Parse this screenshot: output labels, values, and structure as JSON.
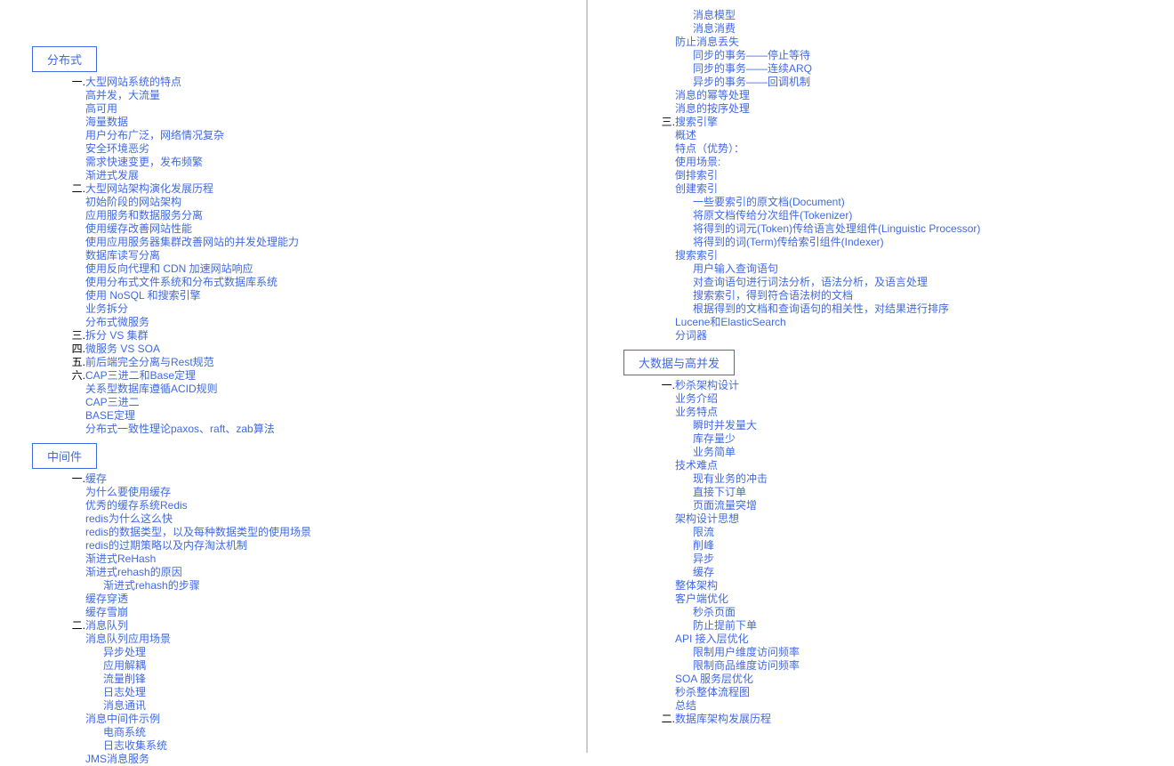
{
  "left": {
    "section1": {
      "title": "分布式",
      "items": [
        {
          "num": "一.",
          "text": "大型网站系统的特点",
          "indent": 0
        },
        {
          "text": "高并发，大流量",
          "indent": 1
        },
        {
          "text": "高可用",
          "indent": 1
        },
        {
          "text": "海量数据",
          "indent": 1
        },
        {
          "text": "用户分布广泛，网络情况复杂",
          "indent": 1
        },
        {
          "text": "安全环境恶劣",
          "indent": 1
        },
        {
          "text": "需求快速变更，发布频繁",
          "indent": 1
        },
        {
          "text": "渐进式发展",
          "indent": 1
        },
        {
          "num": "二.",
          "text": "大型网站架构演化发展历程",
          "indent": 0
        },
        {
          "text": "初始阶段的网站架构",
          "indent": 1
        },
        {
          "text": "应用服务和数据服务分离",
          "indent": 1
        },
        {
          "text": "使用缓存改善网站性能",
          "indent": 1
        },
        {
          "text": "使用应用服务器集群改善网站的并发处理能力",
          "indent": 1
        },
        {
          "text": "数据库读写分离",
          "indent": 1
        },
        {
          "text": "使用反向代理和 CDN 加速网站响应",
          "indent": 1
        },
        {
          "text": "使用分布式文件系统和分布式数据库系统",
          "indent": 1
        },
        {
          "text": "使用 NoSQL 和搜索引擎",
          "indent": 1
        },
        {
          "text": "业务拆分",
          "indent": 1
        },
        {
          "text": "分布式微服务",
          "indent": 1
        },
        {
          "num": "三.",
          "text": "拆分 VS 集群",
          "indent": 0
        },
        {
          "num": "四.",
          "text": "微服务 VS SOA",
          "indent": 0
        },
        {
          "num": "五.",
          "text": "前后端完全分离与Rest规范",
          "indent": 0
        },
        {
          "num": "六.",
          "text": "CAP三进二和Base定理",
          "indent": 0
        },
        {
          "text": "关系型数据库遵循ACID规则",
          "indent": 1
        },
        {
          "text": "CAP三进二",
          "indent": 1
        },
        {
          "text": "BASE定理",
          "indent": 1
        },
        {
          "text": "分布式一致性理论paxos、raft、zab算法",
          "indent": 1
        }
      ]
    },
    "section2": {
      "title": "中间件",
      "items": [
        {
          "num": "一.",
          "text": "缓存",
          "indent": 0
        },
        {
          "text": "为什么要使用缓存",
          "indent": 1
        },
        {
          "text": "优秀的缓存系统Redis",
          "indent": 1
        },
        {
          "text": "redis为什么这么快",
          "indent": 1
        },
        {
          "text": "redis的数据类型，以及每种数据类型的使用场景",
          "indent": 1
        },
        {
          "text": "redis的过期策略以及内存淘汰机制",
          "indent": 1
        },
        {
          "text": "渐进式ReHash",
          "indent": 1
        },
        {
          "text": "渐进式rehash的原因",
          "indent": 1
        },
        {
          "text": "渐进式rehash的步骤",
          "indent": 2
        },
        {
          "text": "缓存穿透",
          "indent": 1
        },
        {
          "text": "缓存雪崩",
          "indent": 1
        },
        {
          "num": "二.",
          "text": "消息队列",
          "indent": 0
        },
        {
          "text": "消息队列应用场景",
          "indent": 1
        },
        {
          "text": "异步处理",
          "indent": 2
        },
        {
          "text": "应用解耦",
          "indent": 2
        },
        {
          "text": "流量削锋",
          "indent": 2
        },
        {
          "text": "日志处理",
          "indent": 2
        },
        {
          "text": "消息通讯",
          "indent": 2
        },
        {
          "text": "消息中间件示例",
          "indent": 1
        },
        {
          "text": "电商系统",
          "indent": 2
        },
        {
          "text": "日志收集系统",
          "indent": 2
        },
        {
          "text": "JMS消息服务",
          "indent": 1
        }
      ]
    }
  },
  "right": {
    "topItems": [
      {
        "text": "消息模型",
        "indent": 2
      },
      {
        "text": "消息消费",
        "indent": 2
      },
      {
        "text": "防止消息丢失",
        "indent": 1
      },
      {
        "text": "同步的事务——停止等待",
        "indent": 2
      },
      {
        "text": "同步的事务——连续ARQ",
        "indent": 2
      },
      {
        "text": "异步的事务——回调机制",
        "indent": 2
      },
      {
        "text": "消息的幂等处理",
        "indent": 1
      },
      {
        "text": "消息的按序处理",
        "indent": 1
      },
      {
        "num": "三.",
        "text": "搜索引擎",
        "indent": 0
      },
      {
        "text": "概述",
        "indent": 1
      },
      {
        "text": "特点（优势）：",
        "indent": 1
      },
      {
        "text": "使用场景:",
        "indent": 1
      },
      {
        "text": "倒排索引",
        "indent": 1
      },
      {
        "text": "创建索引",
        "indent": 1
      },
      {
        "text": "一些要索引的原文档(Document)",
        "indent": 2
      },
      {
        "text": "将原文档传给分次组件(Tokenizer)",
        "indent": 2
      },
      {
        "text": "将得到的词元(Token)传给语言处理组件(Linguistic Processor)",
        "indent": 2
      },
      {
        "text": "将得到的词(Term)传给索引组件(Indexer)",
        "indent": 2
      },
      {
        "text": "搜索索引",
        "indent": 1
      },
      {
        "text": "用户输入查询语句",
        "indent": 2
      },
      {
        "text": "对查询语句进行词法分析，语法分析，及语言处理",
        "indent": 2
      },
      {
        "text": "搜索索引，得到符合语法树的文档",
        "indent": 2
      },
      {
        "text": "根据得到的文档和查询语句的相关性，对结果进行排序",
        "indent": 2
      },
      {
        "text": "Lucene和ElasticSearch",
        "indent": 1
      },
      {
        "text": "分词器",
        "indent": 1
      }
    ],
    "section": {
      "title": "大数据与高并发",
      "items": [
        {
          "num": "一.",
          "text": "秒杀架构设计",
          "indent": 0
        },
        {
          "text": "业务介绍",
          "indent": 1
        },
        {
          "text": "业务特点",
          "indent": 1
        },
        {
          "text": "瞬时并发量大",
          "indent": 2
        },
        {
          "text": "库存量少",
          "indent": 2
        },
        {
          "text": "业务简单",
          "indent": 2
        },
        {
          "text": "技术难点",
          "indent": 1
        },
        {
          "text": "现有业务的冲击",
          "indent": 2
        },
        {
          "text": "直接下订单",
          "indent": 2
        },
        {
          "text": "页面流量突增",
          "indent": 2
        },
        {
          "text": "架构设计思想",
          "indent": 1
        },
        {
          "text": "限流",
          "indent": 2
        },
        {
          "text": "削峰",
          "indent": 2
        },
        {
          "text": "异步",
          "indent": 2
        },
        {
          "text": "缓存",
          "indent": 2
        },
        {
          "text": "整体架构",
          "indent": 1
        },
        {
          "text": "客户端优化",
          "indent": 1
        },
        {
          "text": "秒杀页面",
          "indent": 2
        },
        {
          "text": "防止提前下单",
          "indent": 2
        },
        {
          "text": "API 接入层优化",
          "indent": 1
        },
        {
          "text": "限制用户维度访问频率",
          "indent": 2
        },
        {
          "text": "限制商品维度访问频率",
          "indent": 2
        },
        {
          "text": "SOA 服务层优化",
          "indent": 1
        },
        {
          "text": "秒杀整体流程图",
          "indent": 1
        },
        {
          "text": "总结",
          "indent": 1
        },
        {
          "num": "二.",
          "text": "数据库架构发展历程",
          "indent": 0
        }
      ]
    }
  }
}
